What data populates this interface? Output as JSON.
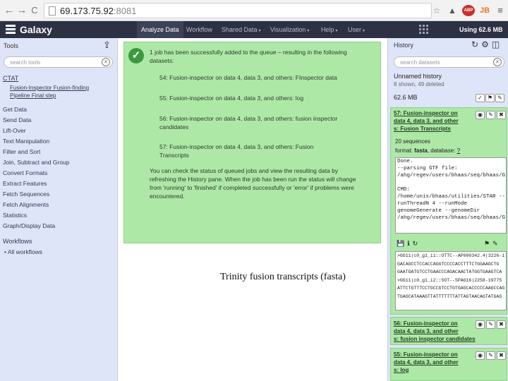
{
  "browser": {
    "url_host": "69.173.75.92",
    "url_port": ":8081",
    "back_glyph": "←",
    "forward_glyph": "→",
    "reload_glyph": "C",
    "ext_icons": [
      "☆",
      "▲",
      "ABP",
      "JB",
      "≡"
    ]
  },
  "masthead": {
    "logo": "Galaxy",
    "tabs": [
      {
        "label": "Analyze Data",
        "dropdown": false
      },
      {
        "label": "Workflow",
        "dropdown": false
      },
      {
        "label": "Shared Data",
        "dropdown": true
      },
      {
        "label": "Visualization",
        "dropdown": true
      },
      {
        "label": "Help",
        "dropdown": true
      },
      {
        "label": "User",
        "dropdown": true
      }
    ],
    "usage": "Using 62.6 MB",
    "caret": "▾"
  },
  "tools": {
    "title": "Tools",
    "search_placeholder": "search tools",
    "section": "CTAT",
    "section_tool_line1": "Fusion-Inspector Fusion-finding",
    "section_tool_line2": "Pipeline Final step",
    "items": [
      "Get Data",
      "Send Data",
      "Lift-Over",
      "Text Manipulation",
      "Filter and Sort",
      "Join, Subtract and Group",
      "Convert Formats",
      "Extract Features",
      "Fetch Sequences",
      "Fetch Alignments",
      "Statistics",
      "Graph/Display Data"
    ],
    "workflows_title": "Workflows",
    "workflows_link": "All workflows"
  },
  "message": {
    "line1": "1 job has been successfully added to the queue – resulting in the following",
    "line2": "datasets:",
    "datasets": [
      {
        "line1": "54: Fusion-inspector on data 4, data 3, and others: FInspector data",
        "line2": ""
      },
      {
        "line1": "55: Fusion-inspector on data 4, data 3, and others: log",
        "line2": ""
      },
      {
        "line1": "56: Fusion-inspector on data 4, data 3, and others: fusion inspector",
        "line2": "candidates"
      },
      {
        "line1": "57: Fusion-inspector on data 4, data 3, and others: Fusion",
        "line2": "Transcripts"
      }
    ],
    "footer": [
      "You can check the status of queued jobs and view the resulting data by",
      "refreshing the History pane. When the job has been run the status will change",
      "from 'running' to 'finished' if completed successfully or 'error' if problems were",
      "encountered."
    ]
  },
  "caption": "Trinity fusion transcripts (fasta)",
  "history": {
    "title": "History",
    "search_placeholder": "search datasets",
    "name": "Unnamed history",
    "counts": "8 shown, 49 deleted",
    "size": "62.6 MB",
    "ds57": {
      "title_lines": [
        "57: Fusion-inspector on",
        "data 4, data 3, and other",
        "s: Fusion Transcripts"
      ],
      "sequences": "20 sequences",
      "format_prefix": "format:",
      "format": "fasta",
      "database_prefix": ", database:",
      "database": "?",
      "info_lines": [
        "Done.",
        "--parsing GTF file:",
        "/ahg/regev/users/bhaas/seq/bhaas/G",
        "",
        "CMD:",
        "/home/unix/bhaas/utilities/STAR --",
        "runThreadN 4 --runMode",
        "genomeGenerate --genomeDir",
        "/ahg/regev/users/bhaas/seq/bhaas/G"
      ],
      "seq_lines": [
        ">GG11|c0_g1_i1::OTTC--AP000342.4|3226-1",
        "GACAGCCTCCACCAGGTCCCCACCTTTCTGGAAGCTG",
        "GAATGATGTCCTGAACCCAGACAACTATGGTGAAGTCA",
        ">GG11|c0_g1_i2::SOT--SPAG16|2258-19775",
        "ATTCTGTTTCCTGCCGTCCTGTGAGCACCCCCAAGCCAG",
        "TGAGCATAAAGTTATTTTTTTATTAGTAACAGTATGAG"
      ]
    },
    "ds56": {
      "title_lines": [
        "56: Fusion-inspector on",
        "data 4, data 3, and other",
        "s: fusion inspector candidates"
      ]
    },
    "ds55": {
      "title_lines": [
        "55: Fusion-inspector on",
        "data 4, data 3, and other",
        "s: log"
      ]
    }
  },
  "colors": {
    "masthead": "#2c3143",
    "panel": "#dfe5f9",
    "ok_green": "#aee8a7",
    "check": "#3c9a3c"
  }
}
